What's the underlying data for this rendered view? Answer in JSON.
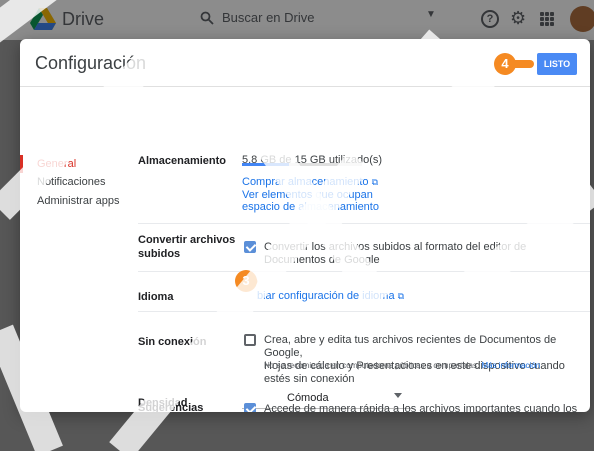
{
  "topbar": {
    "app_name": "Drive",
    "search_placeholder": "Buscar en Drive",
    "help_glyph": "?",
    "gear_glyph": "⚙"
  },
  "dialog": {
    "title": "Configuración",
    "done_label": "LISTO",
    "callouts": [
      "4",
      "3"
    ]
  },
  "sidebar": {
    "items": [
      "General",
      "Notificaciones",
      "Administrar apps"
    ],
    "active": "General"
  },
  "settings": {
    "storage": {
      "label": "Almacenamiento",
      "usage": "5.8 GB de 15 GB utilizado(s)",
      "usage_fraction": 0.39,
      "buy_link": "Comprar almacenamiento",
      "view_link_line1": "Ver elementos que ocupan",
      "view_link_line2": "espacio de almacenamiento"
    },
    "convert": {
      "label_line1": "Convertir archivos",
      "label_line2": "subidos",
      "text": "Convertir los archivos subidos al formato del editor de Documentos de Google",
      "checked": true
    },
    "language": {
      "label": "Idioma",
      "link": "biar configuración de idioma"
    },
    "offline": {
      "label": "Sin conexión",
      "text_line1": "Crea, abre y edita tus archivos recientes de Documentos de Google,",
      "text_line2": "Hojas de cálculo y Presentaciones en este dispositivo cuando estés sin conexión",
      "note": "No se recomienda en computadoras públicas o compartidas.",
      "more_link": "Más información",
      "checked": false
    },
    "density": {
      "label": "Densidad",
      "value": "Cómoda"
    },
    "suggestions": {
      "label": "Sugerencias",
      "text": "Accede de manera rápida a los archivos importantes cuando los",
      "checked": true
    },
    "external_icon": "⧉"
  },
  "colors": {
    "accent": "#4a8af4",
    "callout": "#f58a22",
    "active_nav": "#d93025",
    "link": "#1a73e8"
  }
}
